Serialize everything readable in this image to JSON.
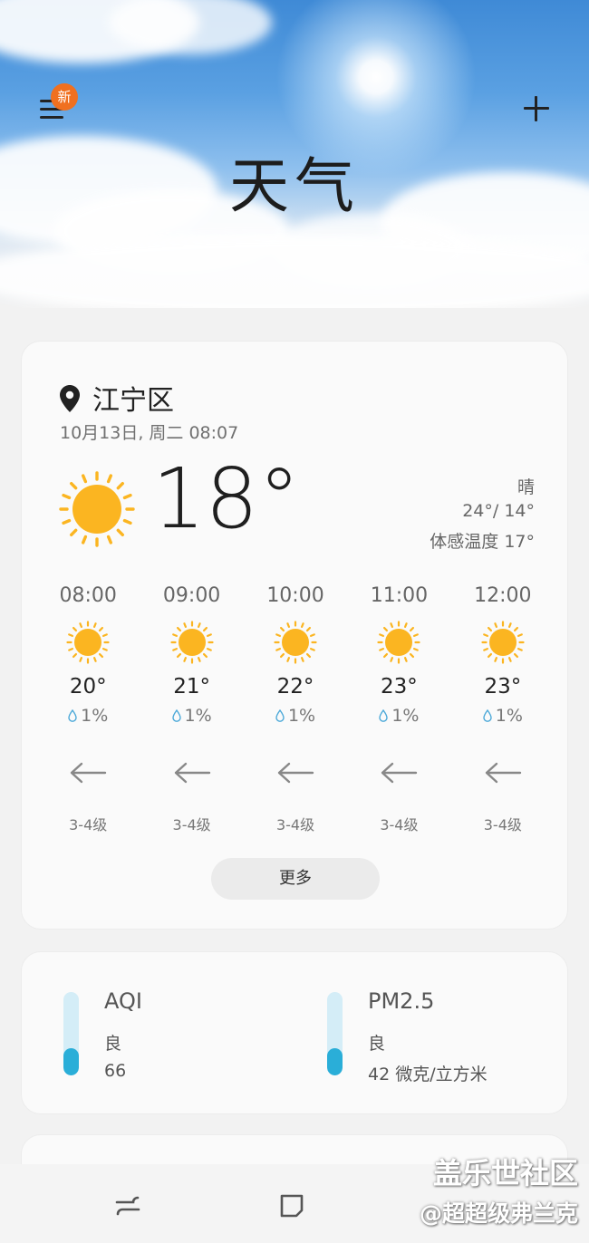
{
  "header": {
    "title": "天气",
    "menu_icon": "hamburger-menu-icon",
    "badge": "新",
    "add_icon": "plus-icon"
  },
  "current": {
    "location": "江宁区",
    "datetime": "10月13日, 周二 08:07",
    "temperature": "18°",
    "condition": "晴",
    "range": "24°/ 14°",
    "feels_like": "体感温度 17°",
    "icon": "sunny-icon"
  },
  "hourly": [
    {
      "time": "08:00",
      "temp": "20°",
      "precip": "1%",
      "wind_level": "3-4级",
      "icon": "sunny-icon",
      "wind_icon": "arrow-left-icon"
    },
    {
      "time": "09:00",
      "temp": "21°",
      "precip": "1%",
      "wind_level": "3-4级",
      "icon": "sunny-icon",
      "wind_icon": "arrow-left-icon"
    },
    {
      "time": "10:00",
      "temp": "22°",
      "precip": "1%",
      "wind_level": "3-4级",
      "icon": "sunny-icon",
      "wind_icon": "arrow-left-icon"
    },
    {
      "time": "11:00",
      "temp": "23°",
      "precip": "1%",
      "wind_level": "3-4级",
      "icon": "sunny-icon",
      "wind_icon": "arrow-left-icon"
    },
    {
      "time": "12:00",
      "temp": "23°",
      "precip": "1%",
      "wind_level": "3-4级",
      "icon": "sunny-icon",
      "wind_icon": "arrow-left-icon"
    }
  ],
  "more_label": "更多",
  "air": {
    "aqi": {
      "label": "AQI",
      "level": "良",
      "value": "66",
      "fill_fraction": 0.33
    },
    "pm25": {
      "label": "PM2.5",
      "level": "良",
      "value": "42 微克/立方米",
      "fill_fraction": 0.33
    }
  },
  "colors": {
    "sun": "#fbb521",
    "gauge_fill": "#2aaed8",
    "gauge_track": "#d4edf7",
    "badge": "#f07020"
  },
  "watermark": {
    "line1": "盖乐世社区",
    "line2": "@超超级弗兰克"
  },
  "nav": {
    "recent_icon": "recent-apps-icon",
    "home_icon": "home-icon"
  }
}
